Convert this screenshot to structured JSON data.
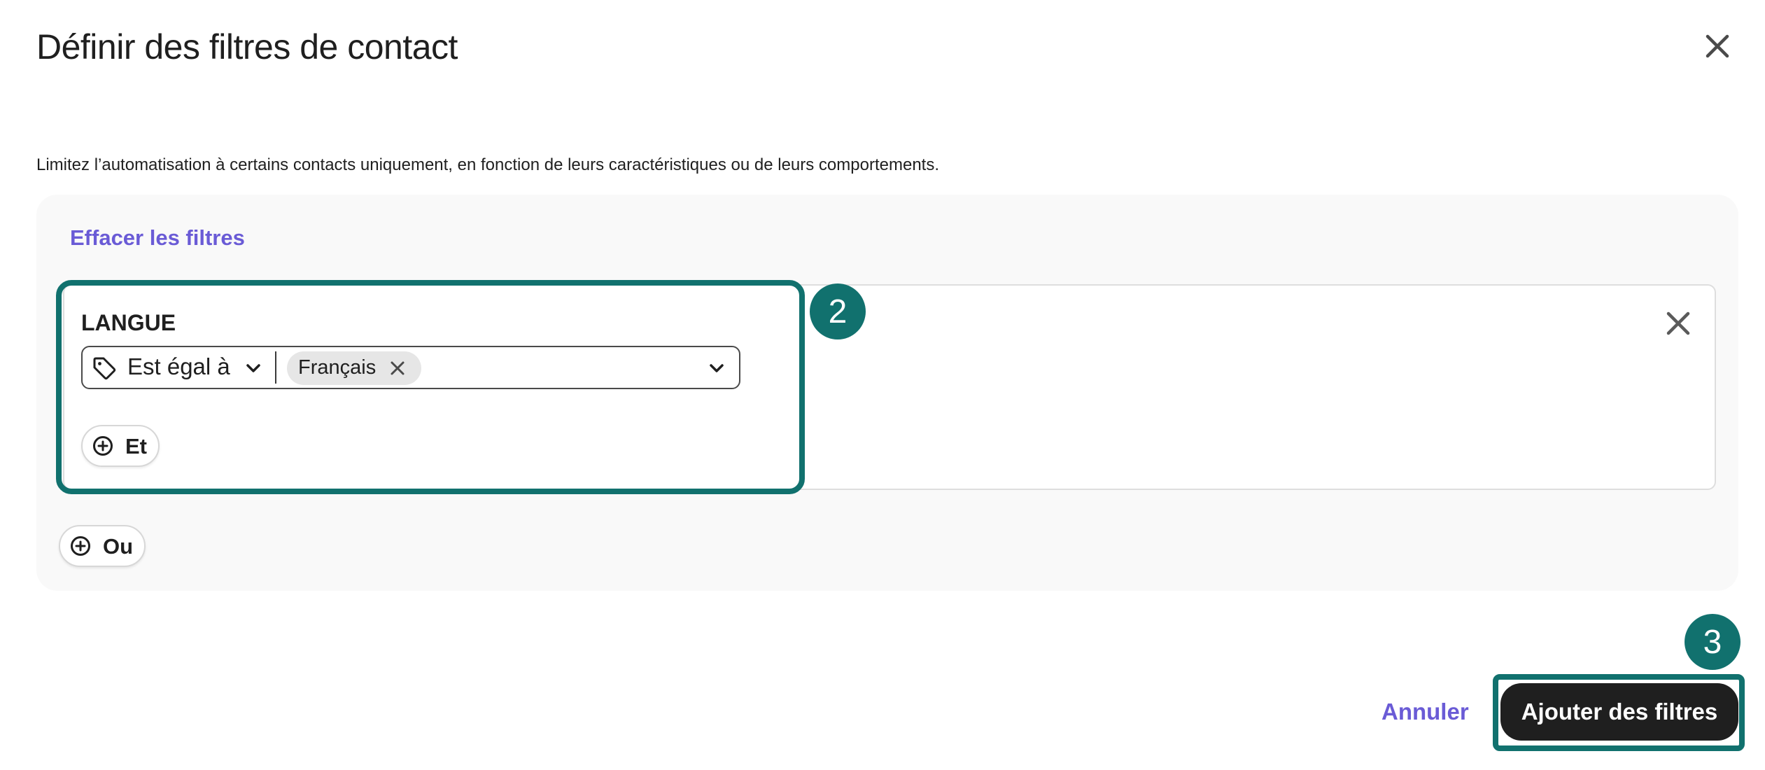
{
  "dialog": {
    "title": "Définir des filtres de contact",
    "description": "Limitez l’automatisation à certains contacts uniquement, en fonction de leurs caractéristiques ou de leurs comportements.",
    "close_icon": "close-icon"
  },
  "filters": {
    "clear_label": "Effacer les filtres",
    "groups": [
      {
        "field_label": "LANGUE",
        "condition": {
          "field_icon": "tag-icon",
          "operator": "Est égal à",
          "values": [
            "Français"
          ]
        },
        "and_label": "Et",
        "remove_icon": "close-icon"
      }
    ],
    "or_label": "Ou"
  },
  "annotations": {
    "step_filter": "2",
    "step_submit": "3",
    "highlight_color": "#11716e"
  },
  "footer": {
    "cancel_label": "Annuler",
    "submit_label": "Ajouter des filtres"
  },
  "colors": {
    "accent": "#6a5bd6",
    "primary_button": "#1f1f1f",
    "panel_bg": "#f9f9f9"
  }
}
